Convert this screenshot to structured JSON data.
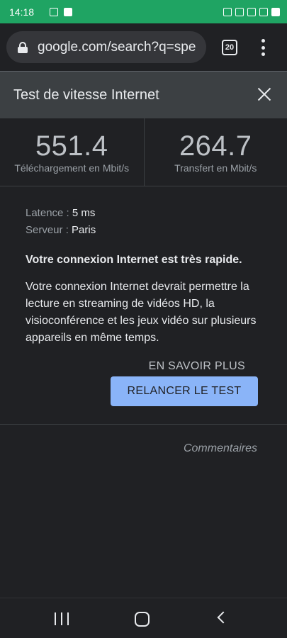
{
  "status_bar": {
    "time": "14:18"
  },
  "browser": {
    "url": "google.com/search?q=spe",
    "tab_count": "20"
  },
  "widget": {
    "title": "Test de vitesse Internet",
    "download": {
      "value": "551.4",
      "unit": "Téléchargement en Mbit/s"
    },
    "upload": {
      "value": "264.7",
      "unit": "Transfert en Mbit/s"
    },
    "latency_label": "Latence : ",
    "latency_value": "5 ms",
    "server_label": "Serveur : ",
    "server_value": "Paris",
    "headline": "Votre connexion Internet est très rapide.",
    "description": "Votre connexion Internet devrait permettre la lecture en streaming de vidéos HD, la visioconférence et les jeux vidéo sur plusieurs appareils en même temps.",
    "learn_more": "EN SAVOIR PLUS",
    "rerun": "RELANCER LE TEST",
    "feedback": "Commentaires"
  },
  "colors": {
    "status_bar": "#1fa463",
    "accent": "#8ab4f8",
    "background": "#202124"
  }
}
